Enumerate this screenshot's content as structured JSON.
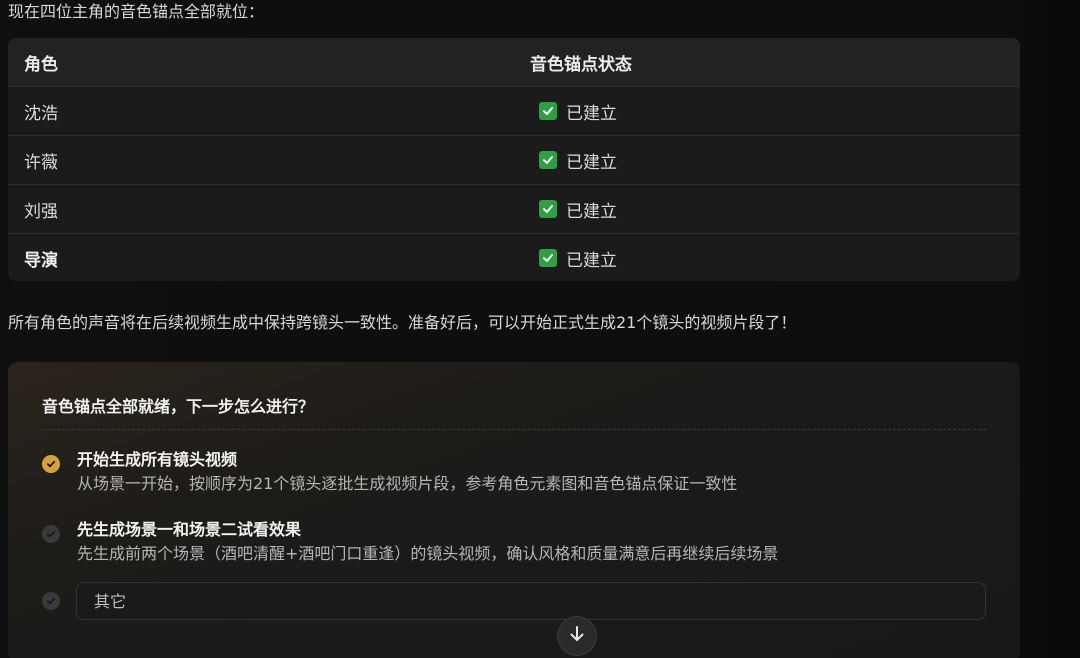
{
  "intro_text": "现在四位主角的音色锚点全部就位：",
  "table": {
    "headers": [
      "角色",
      "音色锚点状态"
    ],
    "rows": [
      {
        "role": "沈浩",
        "status": "已建立"
      },
      {
        "role": "许薇",
        "status": "已建立"
      },
      {
        "role": "刘强",
        "status": "已建立"
      },
      {
        "role": "导演",
        "status": "已建立"
      }
    ]
  },
  "summary_text": "所有角色的声音将在后续视频生成中保持跨镜头一致性。准备好后，可以开始正式生成21个镜头的视频片段了！",
  "question": {
    "title": "音色锚点全部就绪，下一步怎么进行？",
    "options": [
      {
        "title": "开始生成所有镜头视频",
        "desc": "从场景一开始，按顺序为21个镜头逐批生成视频片段，参考角色元素图和音色锚点保证一致性",
        "selected": true
      },
      {
        "title": "先生成场景一和场景二试看效果",
        "desc": "先生成前两个场景（酒吧清醒+酒吧门口重逢）的镜头视频，确认风格和质量满意后再继续后续场景",
        "selected": false
      }
    ],
    "other_placeholder": "其它"
  },
  "colors": {
    "check_green": "#2ea043",
    "selected_gold": "#d4a23a"
  },
  "icons": {
    "status": "checkbox-checked-icon",
    "selected_option": "check-circle-icon",
    "scroll": "arrow-down-icon"
  }
}
